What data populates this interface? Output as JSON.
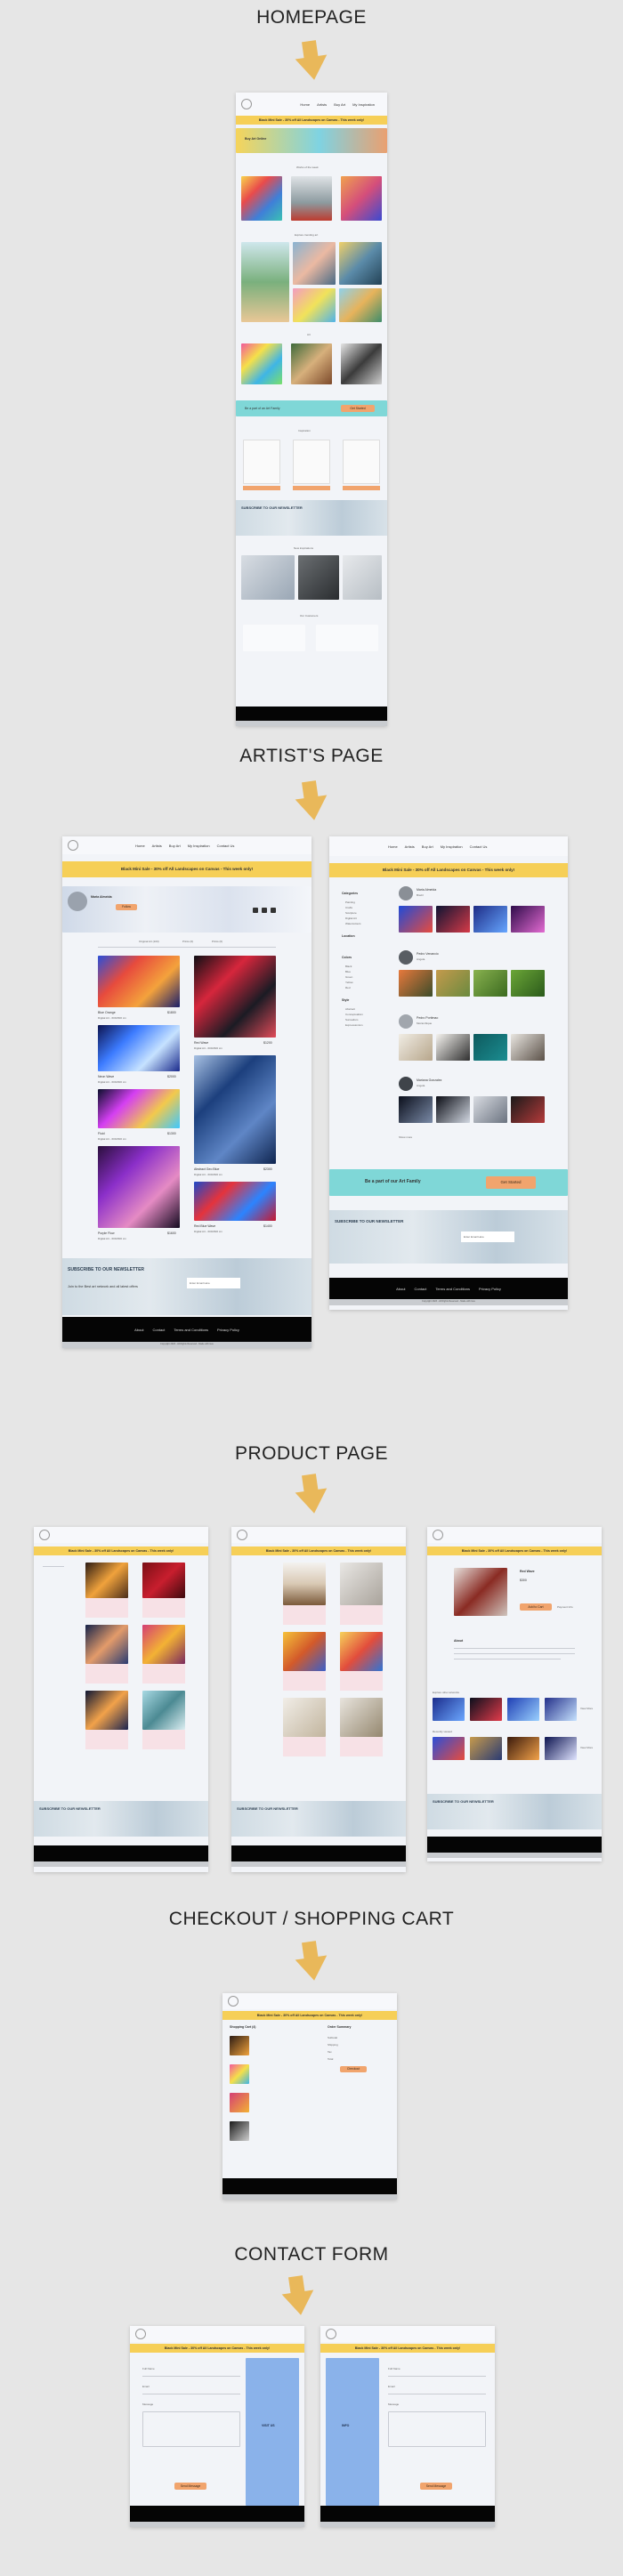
{
  "sections": {
    "homepage": "HOMEPAGE",
    "artist": "ARTIST'S PAGE",
    "product": "PRODUCT PAGE",
    "checkout": "CHECKOUT / SHOPPING CART",
    "contact": "CONTACT FORM"
  },
  "nav": {
    "links": [
      "Home",
      "Artists",
      "Buy Art",
      "My Inspiration",
      "Contact Us"
    ],
    "links_short": [
      "Home",
      "Artists",
      "Buy Art",
      "My Inspiration",
      "Contact Us"
    ]
  },
  "banner_text": "Black Mini Sale - 30% off All Landscapes on Canvas - This week only!",
  "colors": {
    "banner": "#f6cf57",
    "accent_button": "#f1a46d",
    "footer": "#050505",
    "teal_strip": "#7fd7d7",
    "contact_blue": "#8ab2ea",
    "arrow": "#e9b85a"
  },
  "homepage": {
    "hero_label": "Buy Art Online",
    "section_labels": [
      "Works of the week",
      "Explore trending art",
      "Art",
      "Inspiration",
      "New inspirations",
      "Our Customers"
    ],
    "join_text": "Be a part of an Art Family",
    "join_button": "Get Started",
    "newsletter_title": "SUBSCRIBE TO OUR NEWSLETTER"
  },
  "artist": {
    "name_left": "Maria Almeida",
    "products_tabs": [
      "Original Art (103)",
      "Prints (0)",
      "Prints (0)"
    ],
    "follow_button": "Follow",
    "artworks": [
      {
        "title": "Blue Orange",
        "price": "$1800",
        "meta": "Digital Art - 600x500 cm"
      },
      {
        "title": "Red Wave",
        "price": "$1200",
        "meta": "Digital Art - 600x500 cm"
      },
      {
        "title": "Neon Wave",
        "price": "$2000",
        "meta": "Digital Art - 600x500 cm"
      },
      {
        "title": "Fluid",
        "price": "$1300",
        "meta": "Digital Art - 600x500 cm"
      },
      {
        "title": "Abstract Geo Blue",
        "price": "$2300",
        "meta": "Digital Art - 600x500 cm"
      },
      {
        "title": "Purple Flow",
        "price": "$1600",
        "meta": "Digital Art - 600x500 cm"
      },
      {
        "title": "Red Blue Wave",
        "price": "$1400",
        "meta": "Digital Art - 600x500 cm"
      }
    ],
    "newsletter_title": "SUBSCRIBE TO OUR NEWSLETTER",
    "newsletter_sub": "Join to the Best art network and all latest offers",
    "email_placeholder": "Enter Email Here",
    "footer_links": [
      "About",
      "Contact",
      "Terms and Conditions",
      "Privacy Policy"
    ],
    "copyright": "Copyright 2023 - All Rights Reserved - Made with love",
    "right_categories_title": "Categories",
    "right_categories": [
      "Painting",
      "Crafts",
      "Sculpture",
      "Digital Art",
      "Watercolours"
    ],
    "right_location_title": "Location",
    "right_colors_title": "Colors",
    "right_colors": [
      "Black",
      "Blue",
      "Green",
      "Yellow",
      "Red"
    ],
    "right_style_title": "Style",
    "right_style": [
      "Abstract",
      "Conceptualism",
      "Surrealism",
      "Expressionism"
    ],
    "right_artists": [
      {
        "name": "Maria Almeida",
        "location": "Brazil"
      },
      {
        "name": "Pedro Venancio",
        "location": "Angola"
      },
      {
        "name": "Pedro Portimao",
        "location": "Mozambique"
      },
      {
        "name": "Mariana Gonzalez",
        "location": "Angola"
      }
    ],
    "show_more": "Show more",
    "family_text": "Be a part of our Art Family",
    "family_button": "Get Started"
  },
  "product": {
    "detail_title": "Red Wave",
    "detail_price": "$300",
    "add_to_cart": "Add to Cart",
    "payment": "Payment Info",
    "about_title": "About",
    "similar_title": "Explore other artworks",
    "more_title": "Recently viewed",
    "view_more": "View More",
    "newsletter_title": "SUBSCRIBE TO OUR NEWSLETTER"
  },
  "checkout": {
    "cart_title": "Shopping Cart (4)",
    "summary_title": "Order Summary",
    "summary_rows": [
      "Subtotal",
      "Shipping",
      "Tax",
      "Total"
    ],
    "checkout_button": "Checkout"
  },
  "contact": {
    "form_fields": [
      "Full Name",
      "Email",
      "Message"
    ],
    "send_button": "Send Message",
    "panel_title": "VISIT US",
    "panel_title2": "INFO"
  }
}
